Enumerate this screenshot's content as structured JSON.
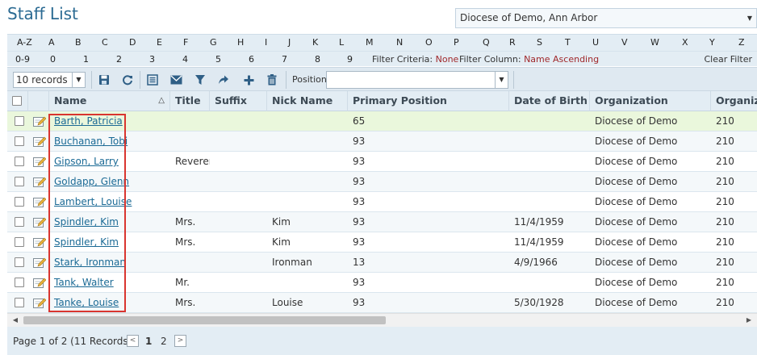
{
  "page": {
    "title": "Staff List"
  },
  "org_select": {
    "value": "Diocese of Demo, Ann Arbor"
  },
  "alpha_bar": {
    "letters": [
      "A-Z",
      "A",
      "B",
      "C",
      "D",
      "E",
      "F",
      "G",
      "H",
      "I",
      "J",
      "K",
      "L",
      "M",
      "N",
      "O",
      "P",
      "Q",
      "R",
      "S",
      "T",
      "U",
      "V",
      "W",
      "X",
      "Y",
      "Z"
    ],
    "digits": [
      "0-9",
      "0",
      "1",
      "2",
      "3",
      "4",
      "5",
      "6",
      "7",
      "8",
      "9"
    ],
    "filter_criteria_label": "Filter Criteria:",
    "filter_criteria_value": "None",
    "filter_column_label": "Filter Column:",
    "filter_column_value": "Name Ascending",
    "clear_filter": "Clear Filter"
  },
  "toolbar": {
    "records_value": "10 records",
    "position_label": "Position",
    "position_value": "",
    "icons": [
      "save-icon",
      "refresh-icon",
      "list-icon",
      "email-icon",
      "filter-icon",
      "share-icon",
      "add-icon",
      "delete-icon"
    ]
  },
  "columns": [
    "Name",
    "Title",
    "Suffix",
    "Nick Name",
    "Primary Position",
    "Date of Birth",
    "Organization",
    "Organiza"
  ],
  "rows": [
    {
      "name": "Barth, Patricia",
      "title": "",
      "suffix": "",
      "nick": "",
      "position": "65",
      "dob": "",
      "org": "Diocese of Demo",
      "org2": "210"
    },
    {
      "name": "Buchanan, Tobi",
      "title": "",
      "suffix": "",
      "nick": "",
      "position": "93",
      "dob": "",
      "org": "Diocese of Demo",
      "org2": "210"
    },
    {
      "name": "Gipson, Larry",
      "title": "Reveren",
      "suffix": "",
      "nick": "",
      "position": "93",
      "dob": "",
      "org": "Diocese of Demo",
      "org2": "210"
    },
    {
      "name": "Goldapp, Glenn",
      "title": "",
      "suffix": "",
      "nick": "",
      "position": "93",
      "dob": "",
      "org": "Diocese of Demo",
      "org2": "210"
    },
    {
      "name": "Lambert, Louise",
      "title": "",
      "suffix": "",
      "nick": "",
      "position": "93",
      "dob": "",
      "org": "Diocese of Demo",
      "org2": "210"
    },
    {
      "name": "Spindler, Kim",
      "title": "Mrs.",
      "suffix": "",
      "nick": "Kim",
      "position": "93",
      "dob": "11/4/1959",
      "org": "Diocese of Demo",
      "org2": "210"
    },
    {
      "name": "Spindler, Kim",
      "title": "Mrs.",
      "suffix": "",
      "nick": "Kim",
      "position": "93",
      "dob": "11/4/1959",
      "org": "Diocese of Demo",
      "org2": "210"
    },
    {
      "name": "Stark, Ironman",
      "title": "",
      "suffix": "",
      "nick": "Ironman",
      "position": "13",
      "dob": "4/9/1966",
      "org": "Diocese of Demo",
      "org2": "210"
    },
    {
      "name": "Tank, Walter",
      "title": "Mr.",
      "suffix": "",
      "nick": "",
      "position": "93",
      "dob": "",
      "org": "Diocese of Demo",
      "org2": "210"
    },
    {
      "name": "Tanke, Louise",
      "title": "Mrs.",
      "suffix": "",
      "nick": "Louise",
      "position": "93",
      "dob": "5/30/1928",
      "org": "Diocese of Demo",
      "org2": "210"
    }
  ],
  "pager": {
    "text": "Page 1 of 2 (11 Records)",
    "pages": [
      "1",
      "2"
    ]
  },
  "colors": {
    "accent": "#2c6b93",
    "link": "#1b6a95",
    "highlight": "#d9352f",
    "selected_row": "#eaf7dc"
  }
}
